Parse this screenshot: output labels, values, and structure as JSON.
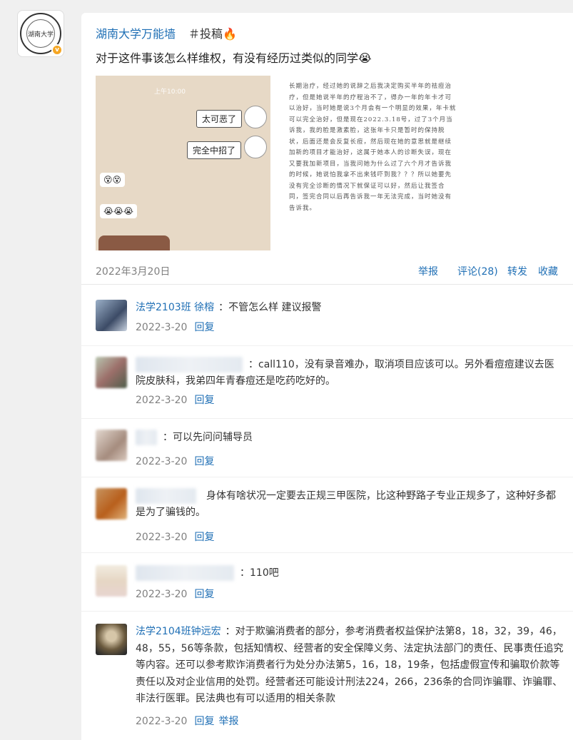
{
  "account": {
    "seal_text": "湖南大学",
    "vip_badge": "v"
  },
  "post": {
    "author": "湖南大学万能墙",
    "tag": "＃投稿🔥",
    "text": "对于这件事该怎么样维权，有没有经历过类似的同学😭",
    "image1": {
      "time": "上午10:00",
      "bubble1": "太可恶了",
      "bubble2": "完全中招了",
      "emoji1": "😵😵",
      "emoji2": "😭😭😭"
    },
    "image2_text": "长期治疗，经过她的说辞之后我决定购买半年的祛痘治疗，但是她说半年的疗程治不了，得办一年的年卡才可以治好，当时她是说3个月会有一个明显的效果，年卡就可以完全治好，但是现在2022.3.18号，过了3个月当诉我，我的脸是激素脸，这张年卡只是暂时的保持脱状，后面还是会反复长痘，然后现在她的意思就是继续加新的项目才能治好，这属于她本人的诊断失误，现在又要我加新项目，当我问她为什么过了六个月才告诉我的时候，她说怕我拿不出来钱吓到我？？？所以她要先没有完全诊断的情况下就保证可以好，然后让我签合同，签完合同以后再告诉我一年无法完成，当时她没有告诉我。",
    "date": "2022年3月20日",
    "actions": {
      "report": "举报",
      "comments": "评论(28)",
      "repost": "转发",
      "favorite": "收藏"
    }
  },
  "comments": [
    {
      "name": "法学2103班 徐榕",
      "text": "：不管怎么样 建议报警",
      "date": "2022-3-20",
      "reply": "回复"
    },
    {
      "name": "",
      "text": "：call110，没有录音难办，取消项目应该可以。另外看痘痘建议去医院皮肤科，我弟四年青春痘还是吃药吃好的。",
      "date": "2022-3-20",
      "reply": "回复"
    },
    {
      "name": "",
      "text": "：可以先问问辅导员",
      "date": "2022-3-20",
      "reply": "回复"
    },
    {
      "name": "",
      "text": "身体有啥状况一定要去正规三甲医院，比这种野路子专业正规多了，这种好多都是为了骗钱的。",
      "date": "2022-3-20",
      "reply": "回复"
    },
    {
      "name": "",
      "text": "：110吧",
      "date": "2022-3-20",
      "reply": "回复"
    },
    {
      "name": "法学2104班钟远宏",
      "text": "：对于欺骗消费者的部分，参考消费者权益保护法第8，18，32，39，46，48，55，56等条款，包括知情权、经营者的安全保障义务、法定执法部门的责任、民事责任追究等内容。还可以参考欺诈消费者行为处分办法第5，16，18，19条，包括虚假宣传和骗取价款等责任以及对企业信用的处罚。经营者还可能设计刑法224，266，236条的合同诈骗罪、诈骗罪、非法行医罪。民法典也有可以适用的相关条款",
      "date": "2022-3-20",
      "reply": "回复",
      "report": "举报"
    }
  ]
}
